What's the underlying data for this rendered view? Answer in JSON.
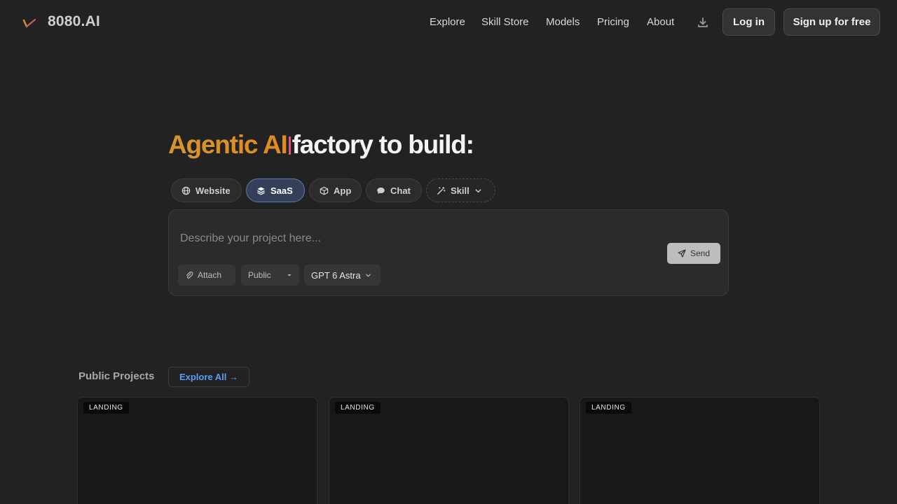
{
  "header": {
    "brand": "8080.AI",
    "nav": [
      "Explore",
      "Skill Store",
      "Models",
      "Pricing",
      "About"
    ],
    "login_label": "Log in",
    "signup_label": "Sign up for free",
    "download_icon": "download-icon"
  },
  "hero": {
    "title_accent": "Agentic AI",
    "title_rest": "factory to build:",
    "chips": [
      {
        "label": "Website",
        "icon": "globe-icon"
      },
      {
        "label": "SaaS",
        "icon": "layers-icon",
        "active": true
      },
      {
        "label": "App",
        "icon": "cube-icon"
      },
      {
        "label": "Chat",
        "icon": "chat-bubble-icon"
      },
      {
        "label": "Skill",
        "icon": "magic-wand-icon"
      }
    ]
  },
  "prompt": {
    "placeholder": "Describe your project here...",
    "send_label": "Send",
    "attach_label": "Attach",
    "visibility_value": "Public",
    "model_value": "GPT 6 Astra"
  },
  "public_projects": {
    "title": "Public Projects",
    "explore_label": "Explore All →",
    "cards": [
      {
        "badge": "LANDING"
      },
      {
        "badge": "LANDING"
      },
      {
        "badge": "LANDING"
      }
    ]
  },
  "colors": {
    "background": "#222222",
    "accent_orange": "#d4962e",
    "active_chip": "#34405a",
    "link_blue": "#5b9cf5"
  }
}
